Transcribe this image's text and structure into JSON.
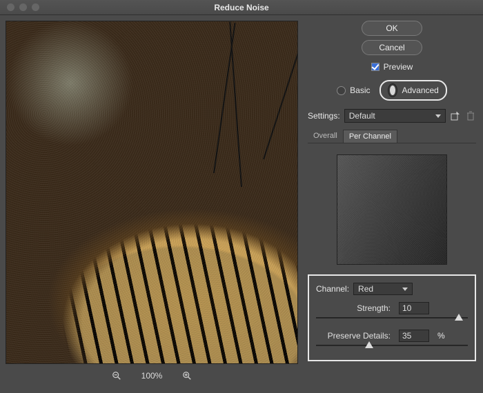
{
  "window": {
    "title": "Reduce Noise"
  },
  "buttons": {
    "ok": "OK",
    "cancel": "Cancel"
  },
  "preview": {
    "label": "Preview",
    "checked": true
  },
  "mode": {
    "basic": "Basic",
    "advanced": "Advanced",
    "selected": "advanced"
  },
  "settings": {
    "label": "Settings:",
    "value": "Default"
  },
  "tabs": {
    "overall": "Overall",
    "perChannel": "Per Channel",
    "active": "perChannel"
  },
  "channel": {
    "label": "Channel:",
    "value": "Red",
    "strength": {
      "label": "Strength:",
      "value": "10",
      "pos": 94
    },
    "preserve": {
      "label": "Preserve Details:",
      "value": "35",
      "unit": "%",
      "pos": 35
    }
  },
  "zoom": {
    "level": "100%"
  }
}
